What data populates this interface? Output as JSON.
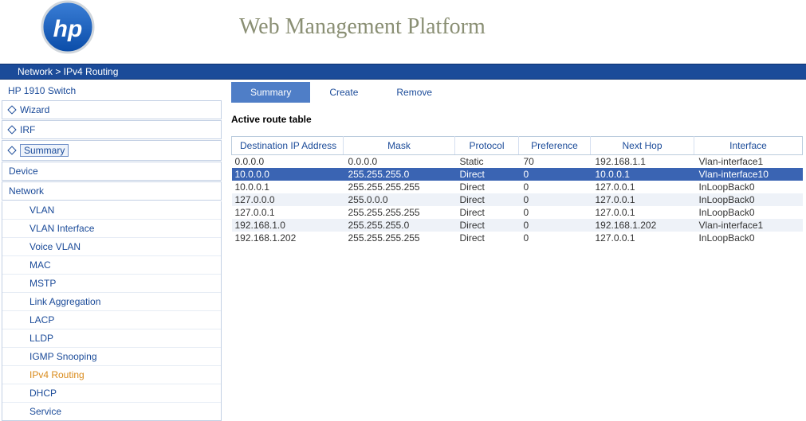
{
  "header": {
    "title": "Web Management Platform",
    "logo_letters": "hp"
  },
  "breadcrumb": "Network > IPv4 Routing",
  "sidebar": {
    "device_title": "HP 1910 Switch",
    "top_items": [
      {
        "label": "Wizard",
        "selected": false
      },
      {
        "label": "IRF",
        "selected": false
      },
      {
        "label": "Summary",
        "selected": true
      }
    ],
    "sections": [
      {
        "label": "Device"
      },
      {
        "label": "Network"
      }
    ],
    "network_items": [
      {
        "label": "VLAN",
        "active": false
      },
      {
        "label": "VLAN Interface",
        "active": false
      },
      {
        "label": "Voice VLAN",
        "active": false
      },
      {
        "label": "MAC",
        "active": false
      },
      {
        "label": "MSTP",
        "active": false
      },
      {
        "label": "Link Aggregation",
        "active": false
      },
      {
        "label": "LACP",
        "active": false
      },
      {
        "label": "LLDP",
        "active": false
      },
      {
        "label": "IGMP Snooping",
        "active": false
      },
      {
        "label": "IPv4 Routing",
        "active": true
      },
      {
        "label": "DHCP",
        "active": false
      },
      {
        "label": "Service",
        "active": false
      }
    ]
  },
  "tabs": [
    {
      "label": "Summary",
      "active": true
    },
    {
      "label": "Create",
      "active": false
    },
    {
      "label": "Remove",
      "active": false
    }
  ],
  "main": {
    "section_title": "Active route table",
    "columns": [
      "Destination IP Address",
      "Mask",
      "Protocol",
      "Preference",
      "Next Hop",
      "Interface"
    ],
    "rows": [
      {
        "dest": "0.0.0.0",
        "mask": "0.0.0.0",
        "proto": "Static",
        "pref": "70",
        "hop": "192.168.1.1",
        "iface": "Vlan-interface1",
        "selected": false
      },
      {
        "dest": "10.0.0.0",
        "mask": "255.255.255.0",
        "proto": "Direct",
        "pref": "0",
        "hop": "10.0.0.1",
        "iface": "Vlan-interface10",
        "selected": true
      },
      {
        "dest": "10.0.0.1",
        "mask": "255.255.255.255",
        "proto": "Direct",
        "pref": "0",
        "hop": "127.0.0.1",
        "iface": "InLoopBack0",
        "selected": false
      },
      {
        "dest": "127.0.0.0",
        "mask": "255.0.0.0",
        "proto": "Direct",
        "pref": "0",
        "hop": "127.0.0.1",
        "iface": "InLoopBack0",
        "selected": false
      },
      {
        "dest": "127.0.0.1",
        "mask": "255.255.255.255",
        "proto": "Direct",
        "pref": "0",
        "hop": "127.0.0.1",
        "iface": "InLoopBack0",
        "selected": false
      },
      {
        "dest": "192.168.1.0",
        "mask": "255.255.255.0",
        "proto": "Direct",
        "pref": "0",
        "hop": "192.168.1.202",
        "iface": "Vlan-interface1",
        "selected": false
      },
      {
        "dest": "192.168.1.202",
        "mask": "255.255.255.255",
        "proto": "Direct",
        "pref": "0",
        "hop": "127.0.0.1",
        "iface": "InLoopBack0",
        "selected": false
      }
    ]
  }
}
